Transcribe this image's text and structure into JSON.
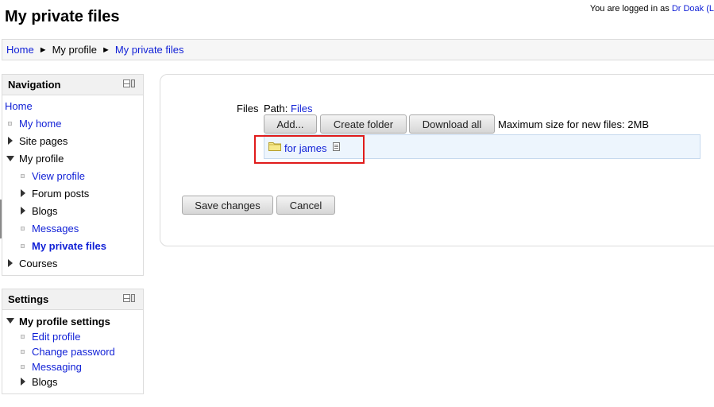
{
  "page": {
    "title": "My private files"
  },
  "login": {
    "prefix": "You are logged in as ",
    "user": "Dr Doak",
    "suffix": "(L"
  },
  "breadcrumb": [
    {
      "label": "Home"
    },
    {
      "label": "My profile"
    },
    {
      "label": "My private files"
    }
  ],
  "breadcrumb_sep": "►",
  "navigation": {
    "title": "Navigation",
    "home": "Home",
    "my_home": "My home",
    "site_pages": "Site pages",
    "my_profile": "My profile",
    "view_profile": "View profile",
    "forum_posts": "Forum posts",
    "blogs": "Blogs",
    "messages": "Messages",
    "my_private_files": "My private files",
    "courses": "Courses"
  },
  "settings": {
    "title": "Settings",
    "section": "My profile settings",
    "edit_profile": "Edit profile",
    "change_password": "Change password",
    "messaging": "Messaging",
    "blogs": "Blogs"
  },
  "files": {
    "label": "Files",
    "path_label": "Path:",
    "path_link": "Files",
    "add_button": "Add...",
    "create_folder_button": "Create folder",
    "download_all_button": "Download all",
    "max_size": "Maximum size for new files: 2MB",
    "folder_name": "for james"
  },
  "form": {
    "save": "Save changes",
    "cancel": "Cancel"
  },
  "colors": {
    "link": "#0f1fd6",
    "highlight": "#e01b1b",
    "file_area": "#edf5fd"
  }
}
